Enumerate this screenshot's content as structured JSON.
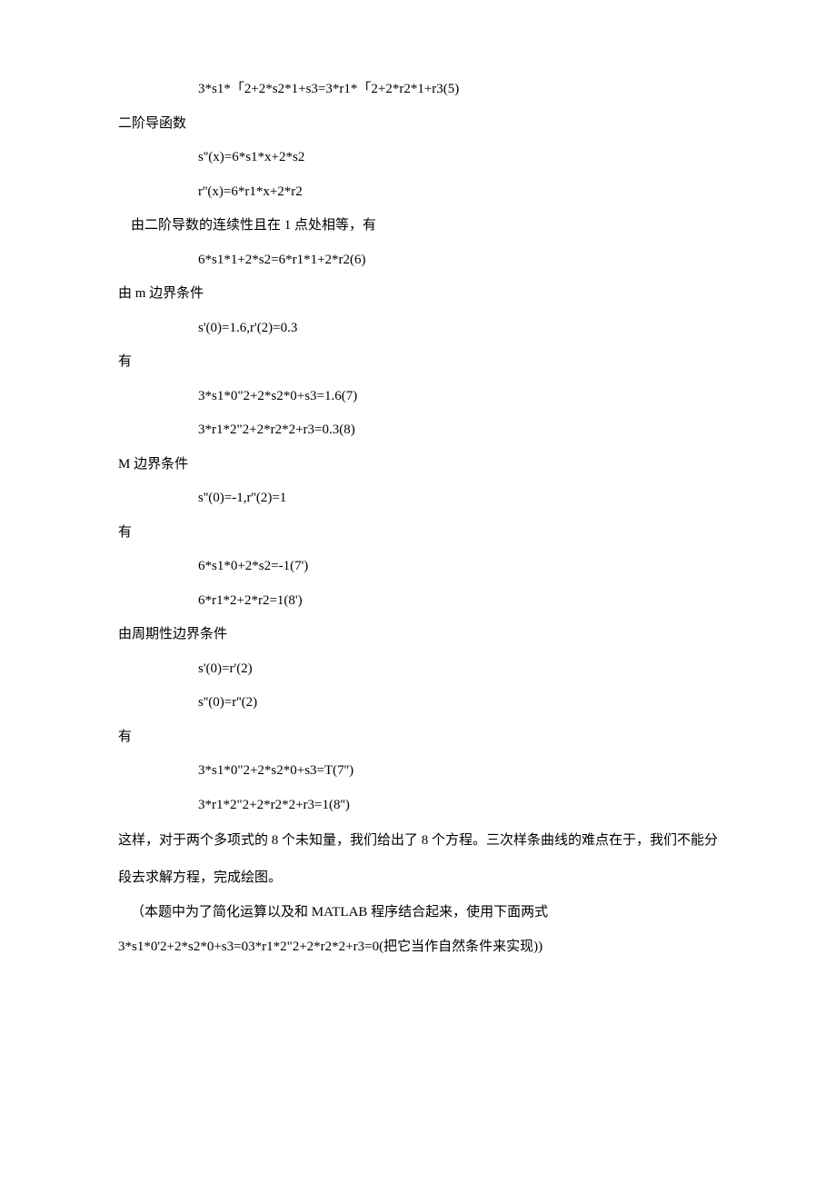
{
  "lines": {
    "eq5": "3*s1*「2+2*s2*1+s3=3*r1*「2+2*r2*1+r3(5)",
    "h_secondderiv": "二阶导函数",
    "s_pp": "s''(x)=6*s1*x+2*s2",
    "r_pp": "r''(x)=6*r1*x+2*r2",
    "cont2": "由二阶导数的连续性且在 1 点处相等，有",
    "eq6": "6*s1*1+2*s2=6*r1*1+2*r2(6)",
    "m_bc": "由 m 边界条件",
    "m_cond": "s'(0)=1.6,r'(2)=0.3",
    "you1": "有",
    "eq7": "3*s1*0\"2+2*s2*0+s3=1.6(7)",
    "eq8": "3*r1*2\"2+2*r2*2+r3=0.3(8)",
    "M_bc": "M 边界条件",
    "M_cond": "s''(0)=-1,r''(2)=1",
    "you2": "有",
    "eq7p": "6*s1*0+2*s2=-1(7')",
    "eq8p": "6*r1*2+2*r2=1(8')",
    "periodic": "由周期性边界条件",
    "per1": "s'(0)=r'(2)",
    "per2": "s''(0)=r''(2)",
    "you3": "有",
    "eq7pp": "3*s1*0\"2+2*s2*0+s3=T(7'')",
    "eq8pp": "3*r1*2\"2+2*r2*2+r3=1(8'')",
    "para1": "这样，对于两个多项式的 8 个未知量，我们给出了 8 个方程。三次样条曲线的难点在于，我们不能分段去求解方程，完成绘图。",
    "para2": "（本题中为了简化运算以及和 MATLAB 程序结合起来，使用下面两式",
    "para3": "3*s1*0'2+2*s2*0+s3=03*r1*2\"2+2*r2*2+r3=0(把它当作自然条件来实现))"
  }
}
